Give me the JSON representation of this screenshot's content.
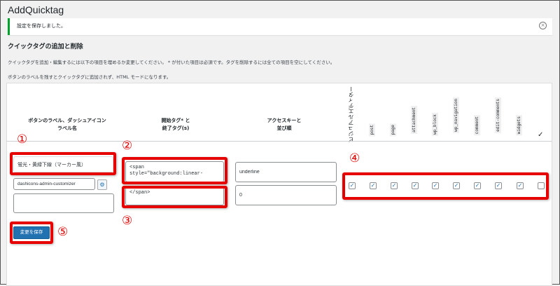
{
  "page": {
    "title": "AddQuicktag"
  },
  "notice": {
    "text": "設定を保存しました。",
    "dismiss_icon": "close-circle-icon"
  },
  "section": {
    "heading": "クイックタグの追加と削除",
    "desc1": "クイックタグを追加・編集するには以下の項目を埋めるか変更してください。 * が付いた項目は必須です。タグを削除するには全ての項目を空にしてください。",
    "desc2": "ボタンのラベルを残すとクイックタグに追加されず、HTML モードになります。"
  },
  "table": {
    "headers": {
      "label_line1": "ボタンのラベル、ダッシュアイコン",
      "label_line2": "ラベル名",
      "tag_line1": "開始タグ* と",
      "tag_line2": "終了タグ(s)",
      "access_line1": "アクセスキーと",
      "access_line2": "並び順"
    },
    "visual_editor": "ビジュアルエディター",
    "post_types": [
      "post",
      "page",
      "attachment",
      "wp_block",
      "wp_navigation",
      "comment",
      "edit-comments",
      "widgets"
    ],
    "select_all_icon": "checkmark-icon",
    "row": {
      "button_label": "蛍光・黄緑下線（マーカー風）",
      "dashicon": "dashicons-admin-customizer",
      "title": "",
      "start_tag": "<span style=\"background:linear-",
      "end_tag": "</span>",
      "access_key": "underline",
      "order": "0",
      "checks": [
        true,
        true,
        true,
        true,
        true,
        true,
        true,
        true,
        true,
        false
      ]
    }
  },
  "save_label": "変更を保存",
  "annotations": [
    "①",
    "②",
    "③",
    "④",
    "⑤"
  ],
  "colors": {
    "accent": "#2271b1",
    "annotation": "#e60000",
    "success": "#00a32a"
  }
}
